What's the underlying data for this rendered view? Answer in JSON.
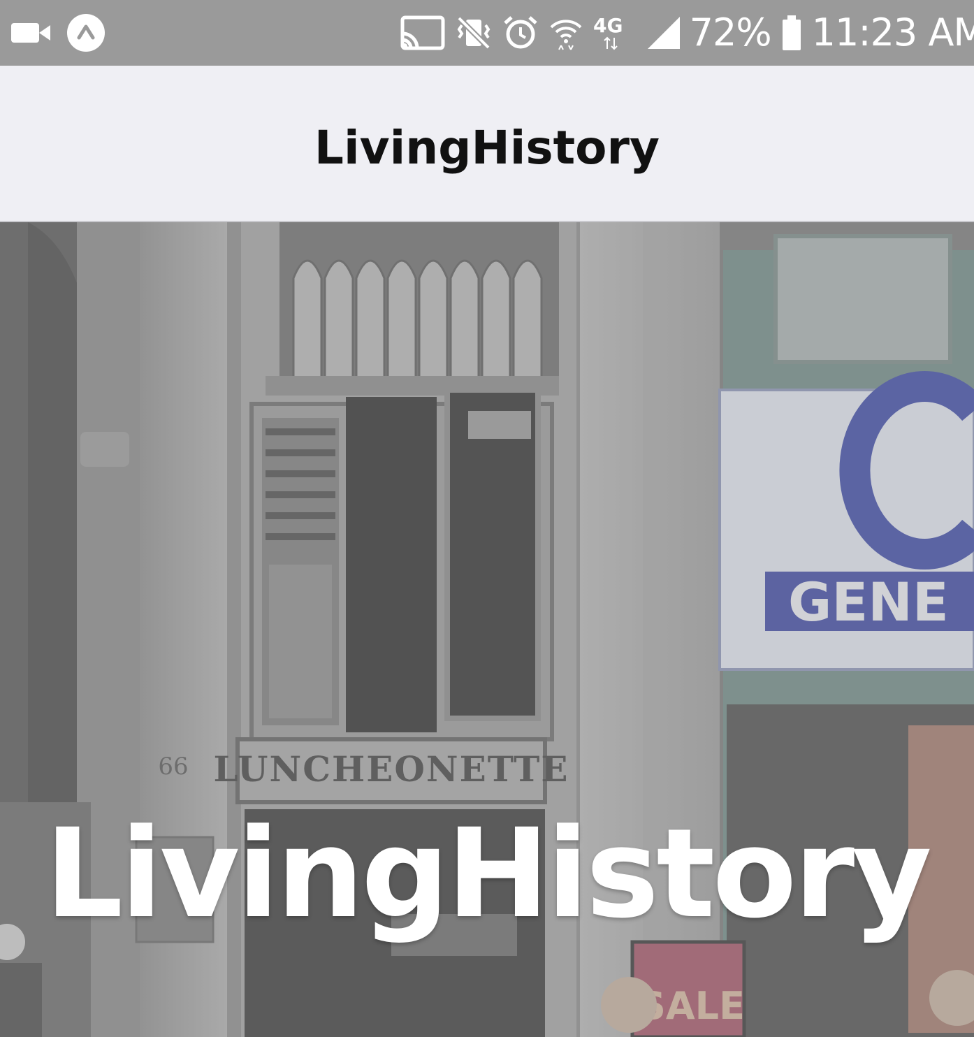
{
  "status_bar": {
    "battery": "72%",
    "time": "11:23 AM",
    "network": "4G",
    "icons": [
      "video-camera-icon",
      "navigation-icon",
      "cast-icon",
      "vibrate-mute-icon",
      "alarm-icon",
      "wifi-icon",
      "lte-icon",
      "signal-icon",
      "battery-icon"
    ]
  },
  "app_bar": {
    "title": "LivingHistory"
  },
  "hero": {
    "title": "LivingHistory",
    "photo_signs": {
      "luncheonette": "LUNCHEONETTE",
      "address_number": "66",
      "store_sign": "GENE",
      "sale_sign": "SALE"
    }
  }
}
